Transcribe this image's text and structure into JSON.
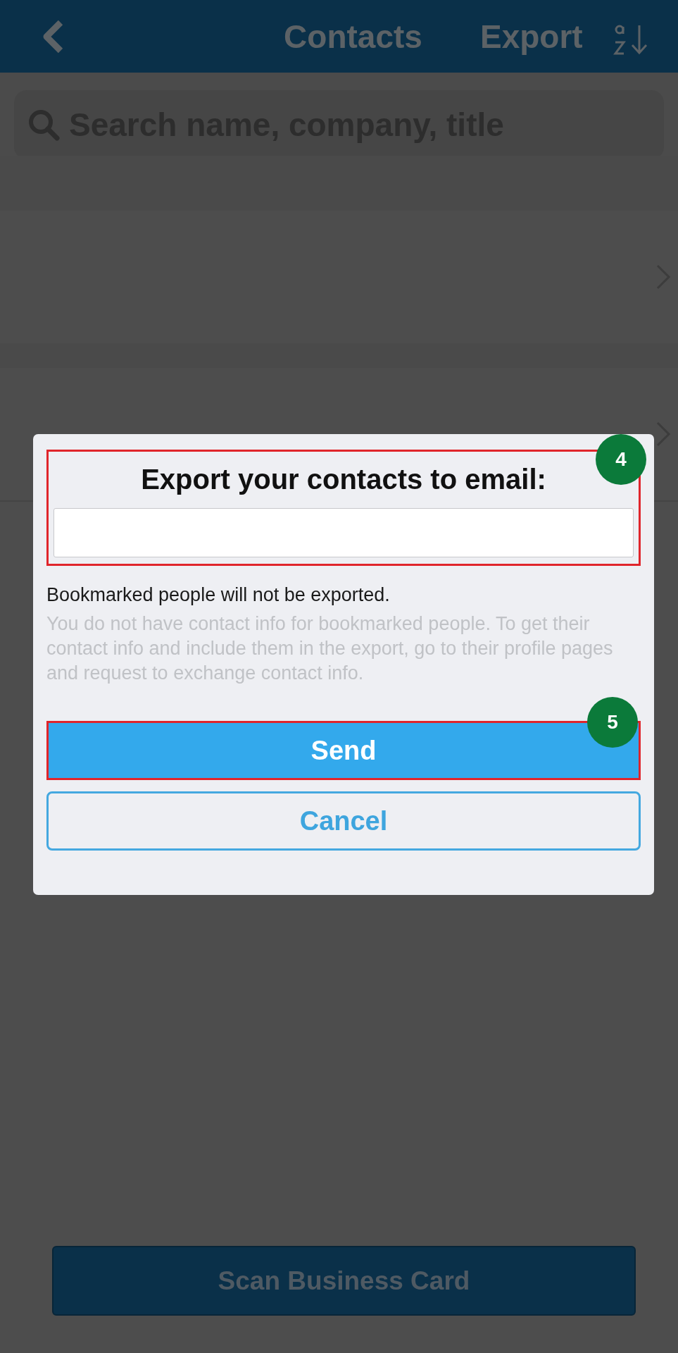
{
  "header": {
    "title": "Contacts",
    "action": "Export"
  },
  "search": {
    "placeholder": "Search name, company, title"
  },
  "contact_rows": [
    {
      "kind": "contact"
    },
    {
      "kind": "contact"
    }
  ],
  "dialog": {
    "title": "Export your contacts to email:",
    "note": "Bookmarked people will not be exported.",
    "description": "You do not have contact info for bookmarked people. To get their contact info and include them in the export, go to their profile pages and request to exchange contact info.",
    "buttons": [
      {
        "label": "Send",
        "kind": "primary"
      },
      {
        "label": "Cancel",
        "kind": "secondary"
      }
    ]
  },
  "annotations": [
    {
      "label": "4"
    },
    {
      "label": "5"
    }
  ],
  "bottom_button": "Scan Business Card"
}
